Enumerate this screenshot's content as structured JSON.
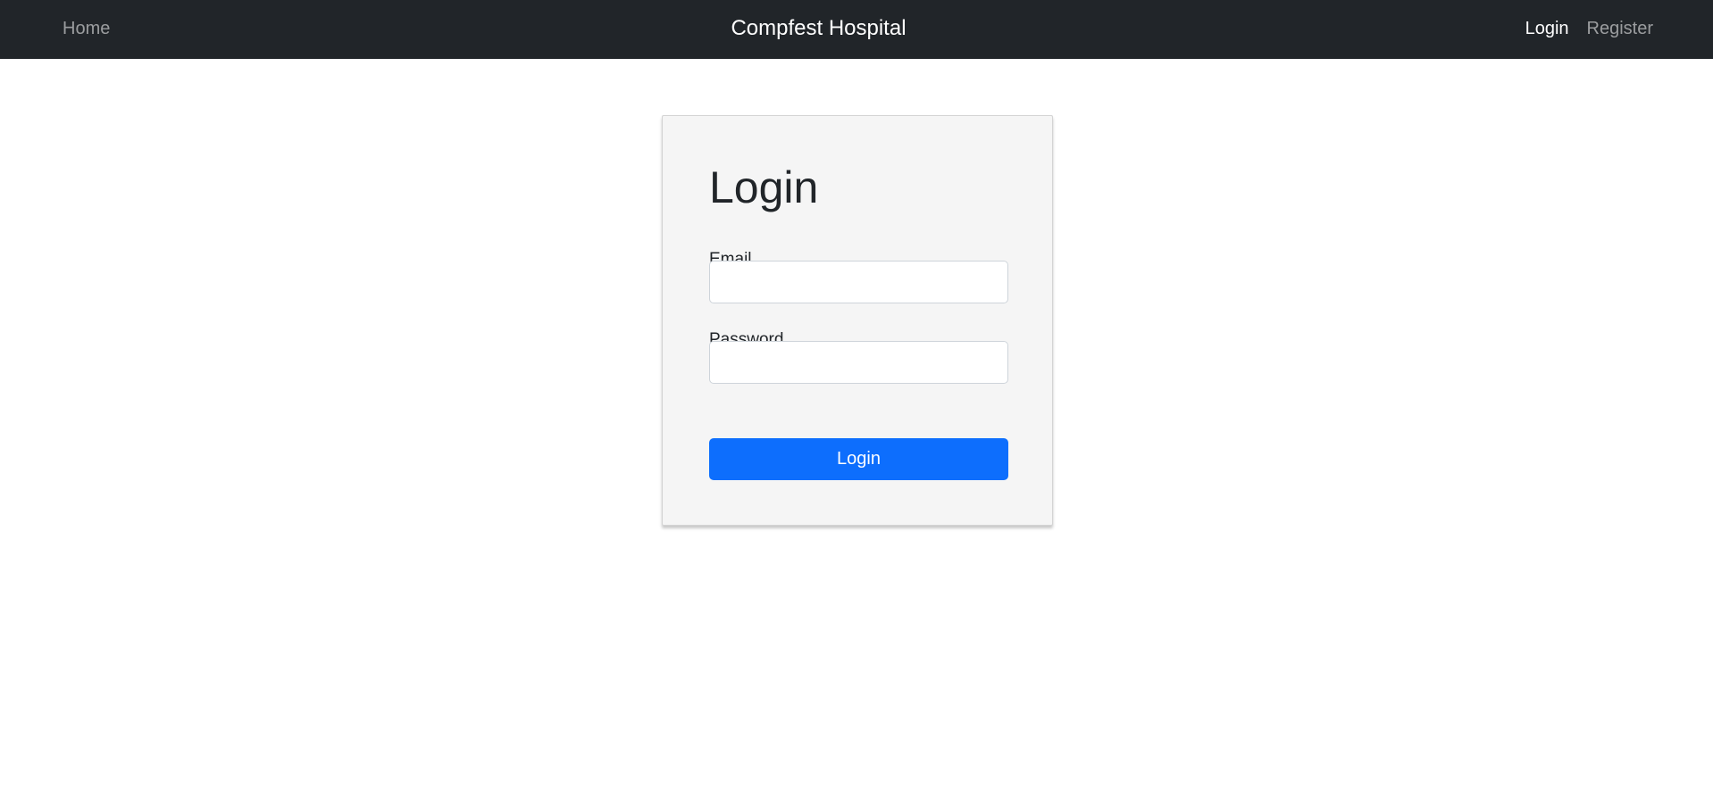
{
  "navbar": {
    "home_label": "Home",
    "brand": "Compfest Hospital",
    "login_label": "Login",
    "register_label": "Register"
  },
  "login_form": {
    "title": "Login",
    "email_label": "Email",
    "email_value": "",
    "password_label": "Password",
    "password_value": "",
    "submit_label": "Login"
  },
  "colors": {
    "navbar_bg": "#212529",
    "primary_button": "#0d6efd",
    "card_bg": "#f5f5f5"
  }
}
